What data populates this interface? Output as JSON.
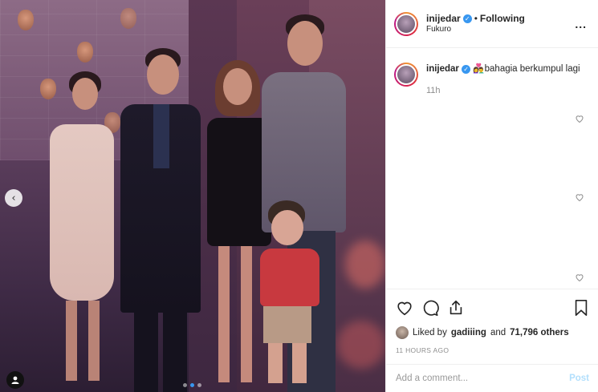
{
  "post": {
    "photo": {
      "carousel_count": 3,
      "active_index": 1
    },
    "header": {
      "username": "inijedar",
      "separator": "•",
      "follow_status": "Following",
      "location": "Fukuro",
      "more": "..."
    },
    "caption": {
      "username": "inijedar",
      "emoji": "👩‍❤️‍👨",
      "text": "bahagia berkumpul lagi",
      "time": "11h"
    },
    "likes": {
      "prefix": "Liked by",
      "user": "gadiiing",
      "and": "and",
      "count": "71,796 others"
    },
    "timestamp": "11 HOURS AGO",
    "comment": {
      "placeholder": "Add a comment...",
      "post_label": "Post"
    },
    "icons": {
      "verified": "verified-badge-icon",
      "like": "heart-icon",
      "comment": "comment-icon",
      "share": "share-icon",
      "save": "bookmark-icon",
      "prev": "chevron-left-icon",
      "tag": "user-tag-icon"
    },
    "colors": {
      "accent": "#3897f0",
      "muted": "#8e8e8e",
      "post_disabled": "#b2dffc"
    }
  }
}
